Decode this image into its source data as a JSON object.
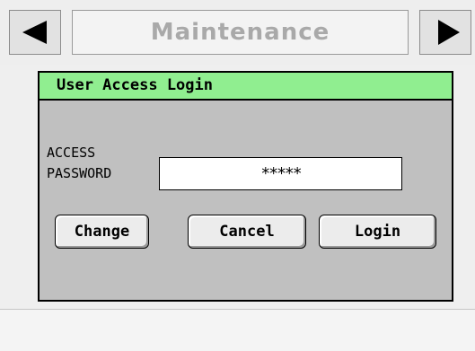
{
  "header": {
    "title": "Maintenance",
    "prev_icon": "left-triangle-icon",
    "next_icon": "right-triangle-icon"
  },
  "dialog": {
    "title": "User Access Login",
    "password_label_line1": "ACCESS",
    "password_label_line2": "PASSWORD",
    "password_value": "*****",
    "buttons": {
      "change": "Change",
      "cancel": "Cancel",
      "login": "Login"
    }
  },
  "colors": {
    "dialog_title_bg": "#90EE90",
    "dialog_bg": "#C0C0C0",
    "header_title_text": "#A9A9A9",
    "button_bg": "#ECECEC"
  }
}
